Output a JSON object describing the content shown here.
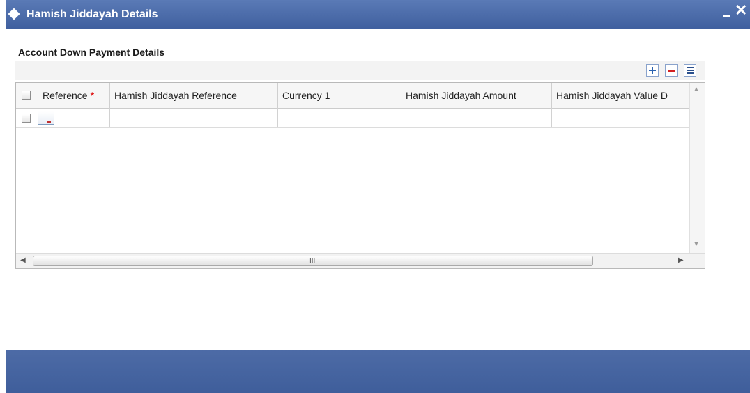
{
  "window": {
    "title": "Hamish Jiddayah Details"
  },
  "section": {
    "title": "Account Down Payment Details"
  },
  "grid": {
    "columns": [
      {
        "label": "Reference",
        "required": true
      },
      {
        "label": "Hamish Jiddayah Reference"
      },
      {
        "label": "Currency 1"
      },
      {
        "label": "Hamish Jiddayah Amount"
      },
      {
        "label": "Hamish Jiddayah Value D"
      }
    ],
    "required_marker": "*",
    "scroll_grip": "III"
  },
  "icons": {
    "title": "diamond-icon",
    "minimize": "minimize-icon",
    "close": "close-icon",
    "add": "plus-icon",
    "remove": "minus-icon",
    "view": "list-icon"
  },
  "colors": {
    "titlebar": "#4a6aa8",
    "footer": "#4565a2",
    "required": "#e02020"
  }
}
